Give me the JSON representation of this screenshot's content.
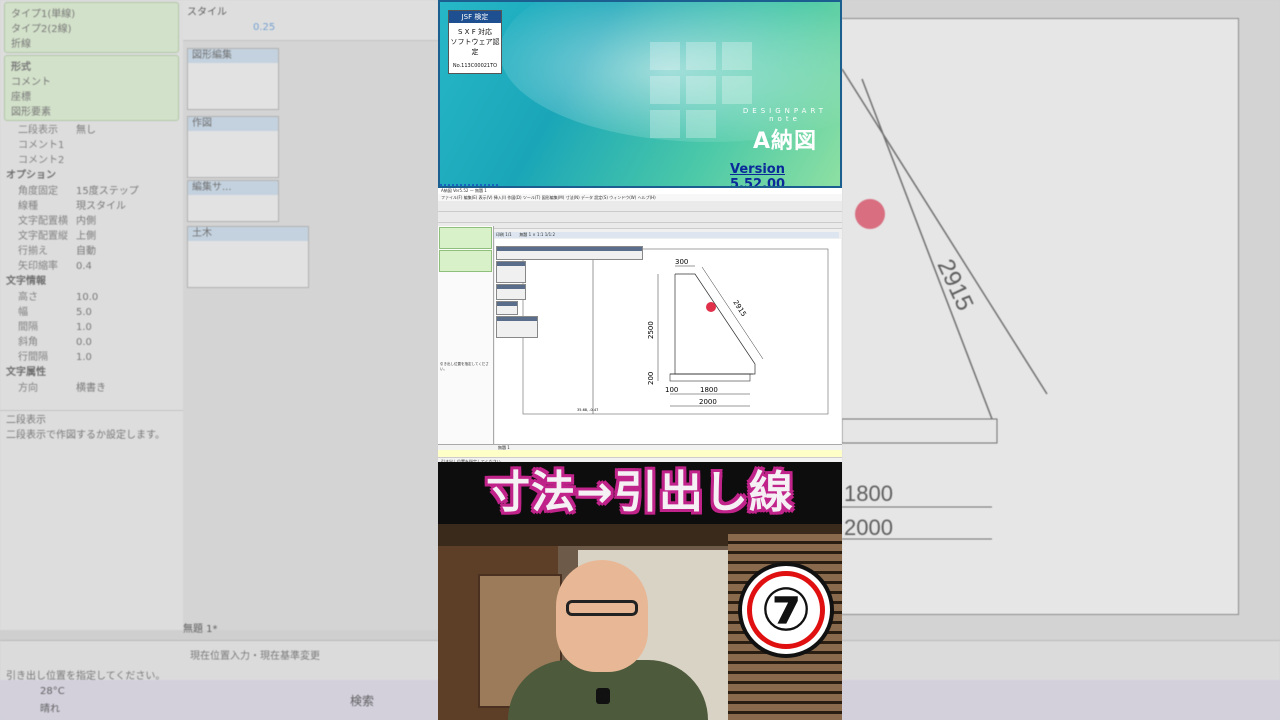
{
  "background": {
    "left_panel": {
      "rows_top": [
        "タイプ1(単線)",
        "タイプ2(2線)",
        "折線"
      ],
      "format_header": "形式",
      "format_options": [
        "コメント",
        "座標",
        "図形要素"
      ],
      "props": [
        {
          "k": "二段表示",
          "v": "無し"
        },
        {
          "k": "コメント1",
          "v": ""
        },
        {
          "k": "コメント2",
          "v": ""
        }
      ],
      "options_header": "オプション",
      "options": [
        {
          "k": "角度固定",
          "v": "15度ステップ"
        },
        {
          "k": "線種",
          "v": "現スタイル"
        },
        {
          "k": "文字配置横",
          "v": "内側"
        },
        {
          "k": "文字配置縦",
          "v": "上側"
        },
        {
          "k": "行揃え",
          "v": "自動"
        },
        {
          "k": "矢印縮率",
          "v": "0.4"
        }
      ],
      "textinfo_header": "文字情報",
      "textinfo": [
        {
          "k": "高さ",
          "v": "10.0"
        },
        {
          "k": "幅",
          "v": "5.0"
        },
        {
          "k": "間隔",
          "v": "1.0"
        },
        {
          "k": "斜角",
          "v": "0.0"
        },
        {
          "k": "行間隔",
          "v": "1.0"
        }
      ],
      "attr_header": "文字属性",
      "attr": [
        {
          "k": "方向",
          "v": "横書き"
        }
      ],
      "help_title": "二段表示",
      "help_text": "二段表示で作図するか設定します。"
    },
    "style_label": "スタイル",
    "style_value": "0.25",
    "palettes": [
      "図形編集",
      "作図",
      "編集サ...",
      "土木"
    ],
    "sheet_tab": "無題 1*",
    "status_bar": "現在位置入力・現在基準変更",
    "status_hint": "引き出し位置を指定してください。",
    "weather_temp": "28°C",
    "weather_state": "晴れ",
    "search_label": "検索",
    "drawing_dims": [
      "2915",
      "1800",
      "2000"
    ]
  },
  "splash": {
    "badge_top": "JSF 検定",
    "badge_lines": [
      "S X F 対応",
      "ソフトウェア認定"
    ],
    "badge_no": "No.113C00021TO",
    "brand_small": "DESIGNPART",
    "brand_note": "note",
    "brand_big": "A納図",
    "version": "Version 5.52.00",
    "progress": 0.15
  },
  "cad": {
    "title": "A納図 Ver5.52 — 無題 1",
    "menu": [
      "ファイル(F)",
      "編集(E)",
      "表示(V)",
      "挿入(I)",
      "作図(D)",
      "ツール(T)",
      "図形編集(M)",
      "寸法(N)",
      "データ",
      "設定(S)",
      "ウィンドウ(W)",
      "ヘルプ(H)"
    ],
    "tab1": "印刷 1/1",
    "tab2": "無題 1 × 1:1 1/1:2",
    "side_hint": "引き出し位置を指定してください。",
    "sheet_tab": "無題 1",
    "coord": "35.68, -0.47",
    "dims": {
      "top": "300",
      "height": "2500",
      "slope": "2915",
      "base": "200",
      "left_offset": "100",
      "inner": "1800",
      "total": "2000"
    },
    "status": "引き出し位置を指定してください。",
    "temp": "28°C"
  },
  "caption": "寸法→引出し線",
  "badge_number": "⑦"
}
